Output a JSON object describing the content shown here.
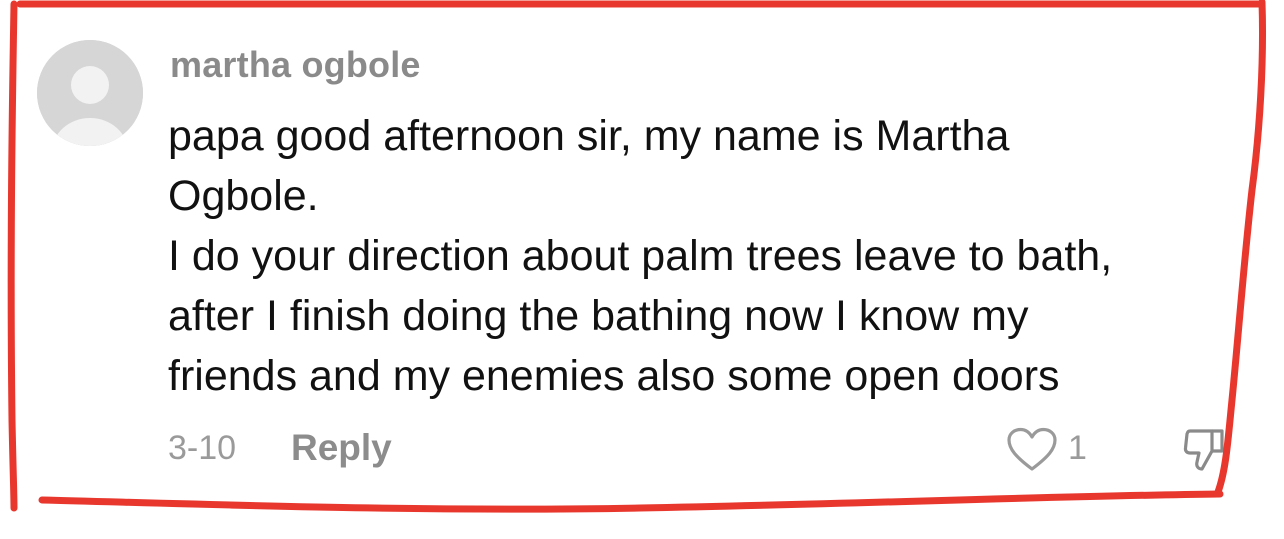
{
  "comment": {
    "username": "martha ogbole",
    "lines": [
      "papa good afternoon sir, my name is Martha",
      "Ogbole.",
      "I do your direction about palm trees leave to bath,",
      "after I finish doing the bathing now I know my",
      "friends and my enemies also some open doors"
    ],
    "date": "3-10",
    "reply_label": "Reply",
    "like_count": "1"
  },
  "icons": {
    "avatar": "default-avatar-icon",
    "like": "heart-outline-icon",
    "dislike": "thumbs-down-icon"
  },
  "colors": {
    "highlight_outline": "#e8382e",
    "meta_text": "#9a9a9a",
    "avatar_bg": "#d6d6d6"
  }
}
